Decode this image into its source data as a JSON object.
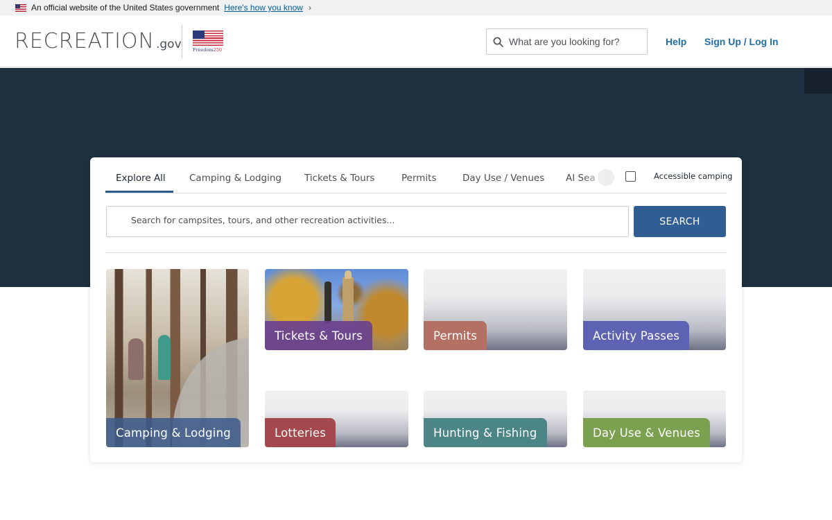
{
  "gov_banner": {
    "text": "An official website of the United States government",
    "link": "Here's how you know",
    "chevron": "›"
  },
  "header": {
    "logo_main": "RECREATION",
    "logo_suffix": ".gov",
    "freedom_text": "Freedom",
    "freedom_number": "250",
    "search_placeholder": "What are you looking for?",
    "search_icon": "search-icon",
    "help": "Help",
    "signup": "Sign Up / Log In"
  },
  "search_card": {
    "tabs": [
      {
        "label": "Explore All"
      },
      {
        "label": "Camping & Lodging"
      },
      {
        "label": "Tickets & Tours"
      },
      {
        "label": "Permits"
      },
      {
        "label": "Day Use / Venues"
      },
      {
        "label": "AI Sea"
      }
    ],
    "accessible_label": "Accessible camping",
    "search_placeholder": "Search for campsites, tours, and other recreation activities...",
    "search_button": "SEARCH",
    "tiles": [
      {
        "label": "Camping & Lodging",
        "color": "#3c5a8c"
      },
      {
        "label": "Tickets & Tours",
        "color": "#6a3f8f"
      },
      {
        "label": "Permits",
        "color": "#b47063"
      },
      {
        "label": "Activity Passes",
        "color": "#5d62b3"
      },
      {
        "label": "Lotteries",
        "color": "#a4484d"
      },
      {
        "label": "Hunting & Fishing",
        "color": "#4c8586"
      },
      {
        "label": "Day Use & Venues",
        "color": "#7ba04f"
      }
    ]
  },
  "colors": {
    "hero_background": "#1e2f40",
    "search_button": "#2f5d94",
    "link": "#1e6fa8"
  }
}
